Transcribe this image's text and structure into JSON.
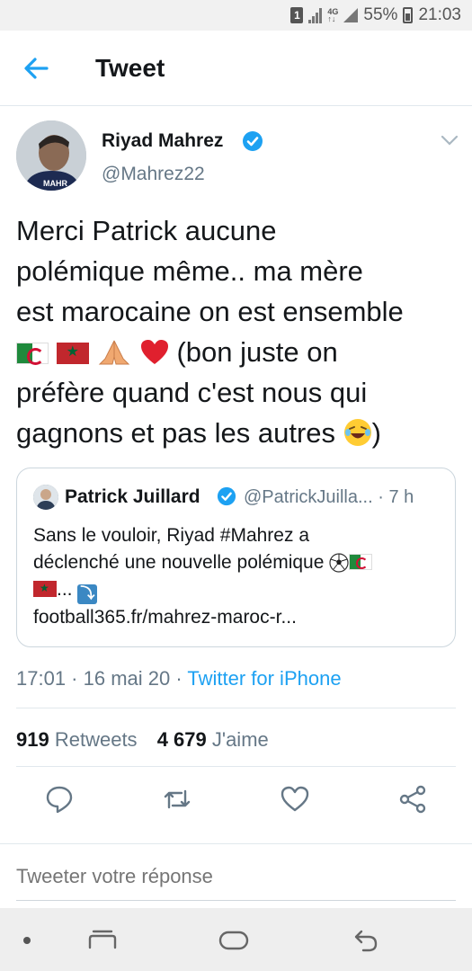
{
  "status_bar": {
    "sim": "1",
    "network": "4G",
    "battery": "55%",
    "time": "21:03"
  },
  "header": {
    "title": "Tweet",
    "back_icon": "arrow-left-icon"
  },
  "tweet": {
    "author_name": "Riyad Mahrez",
    "author_handle": "@Mahrez22",
    "text_line1": "Merci Patrick aucune",
    "text_line2": "polémique même.. ma mère",
    "text_line3": "est marocaine on est ensemble",
    "text_line4_after_emoji": " (bon juste on",
    "text_line5": "préfère quand c'est nous qui",
    "text_line6": "gagnons et pas les autres ",
    "text_line6_end": ")",
    "timestamp": "17:01 · 16 mai 20 · ",
    "source": "Twitter for iPhone",
    "retweets_count": "919",
    "retweets_label": "Retweets",
    "likes_count": "4 679",
    "likes_label": "J'aime"
  },
  "quoted_tweet": {
    "author_name": "Patrick Juillard",
    "author_handle": "@PatrickJuilla...",
    "age": "· 7 h",
    "text_line1": "Sans le vouloir, Riyad #Mahrez a",
    "text_line2": "déclenché une nouvelle polémique ",
    "text_line3_after": "... ",
    "link": "football365.fr/mahrez-maroc-r..."
  },
  "reply": {
    "placeholder": "Tweeter votre réponse"
  },
  "colors": {
    "accent": "#1da1f2",
    "text": "#14171a",
    "secondary": "#657786",
    "border": "#e1e8ed"
  },
  "icons": {
    "reply": "comment-icon",
    "retweet": "retweet-icon",
    "like": "heart-icon",
    "share": "share-icon"
  }
}
